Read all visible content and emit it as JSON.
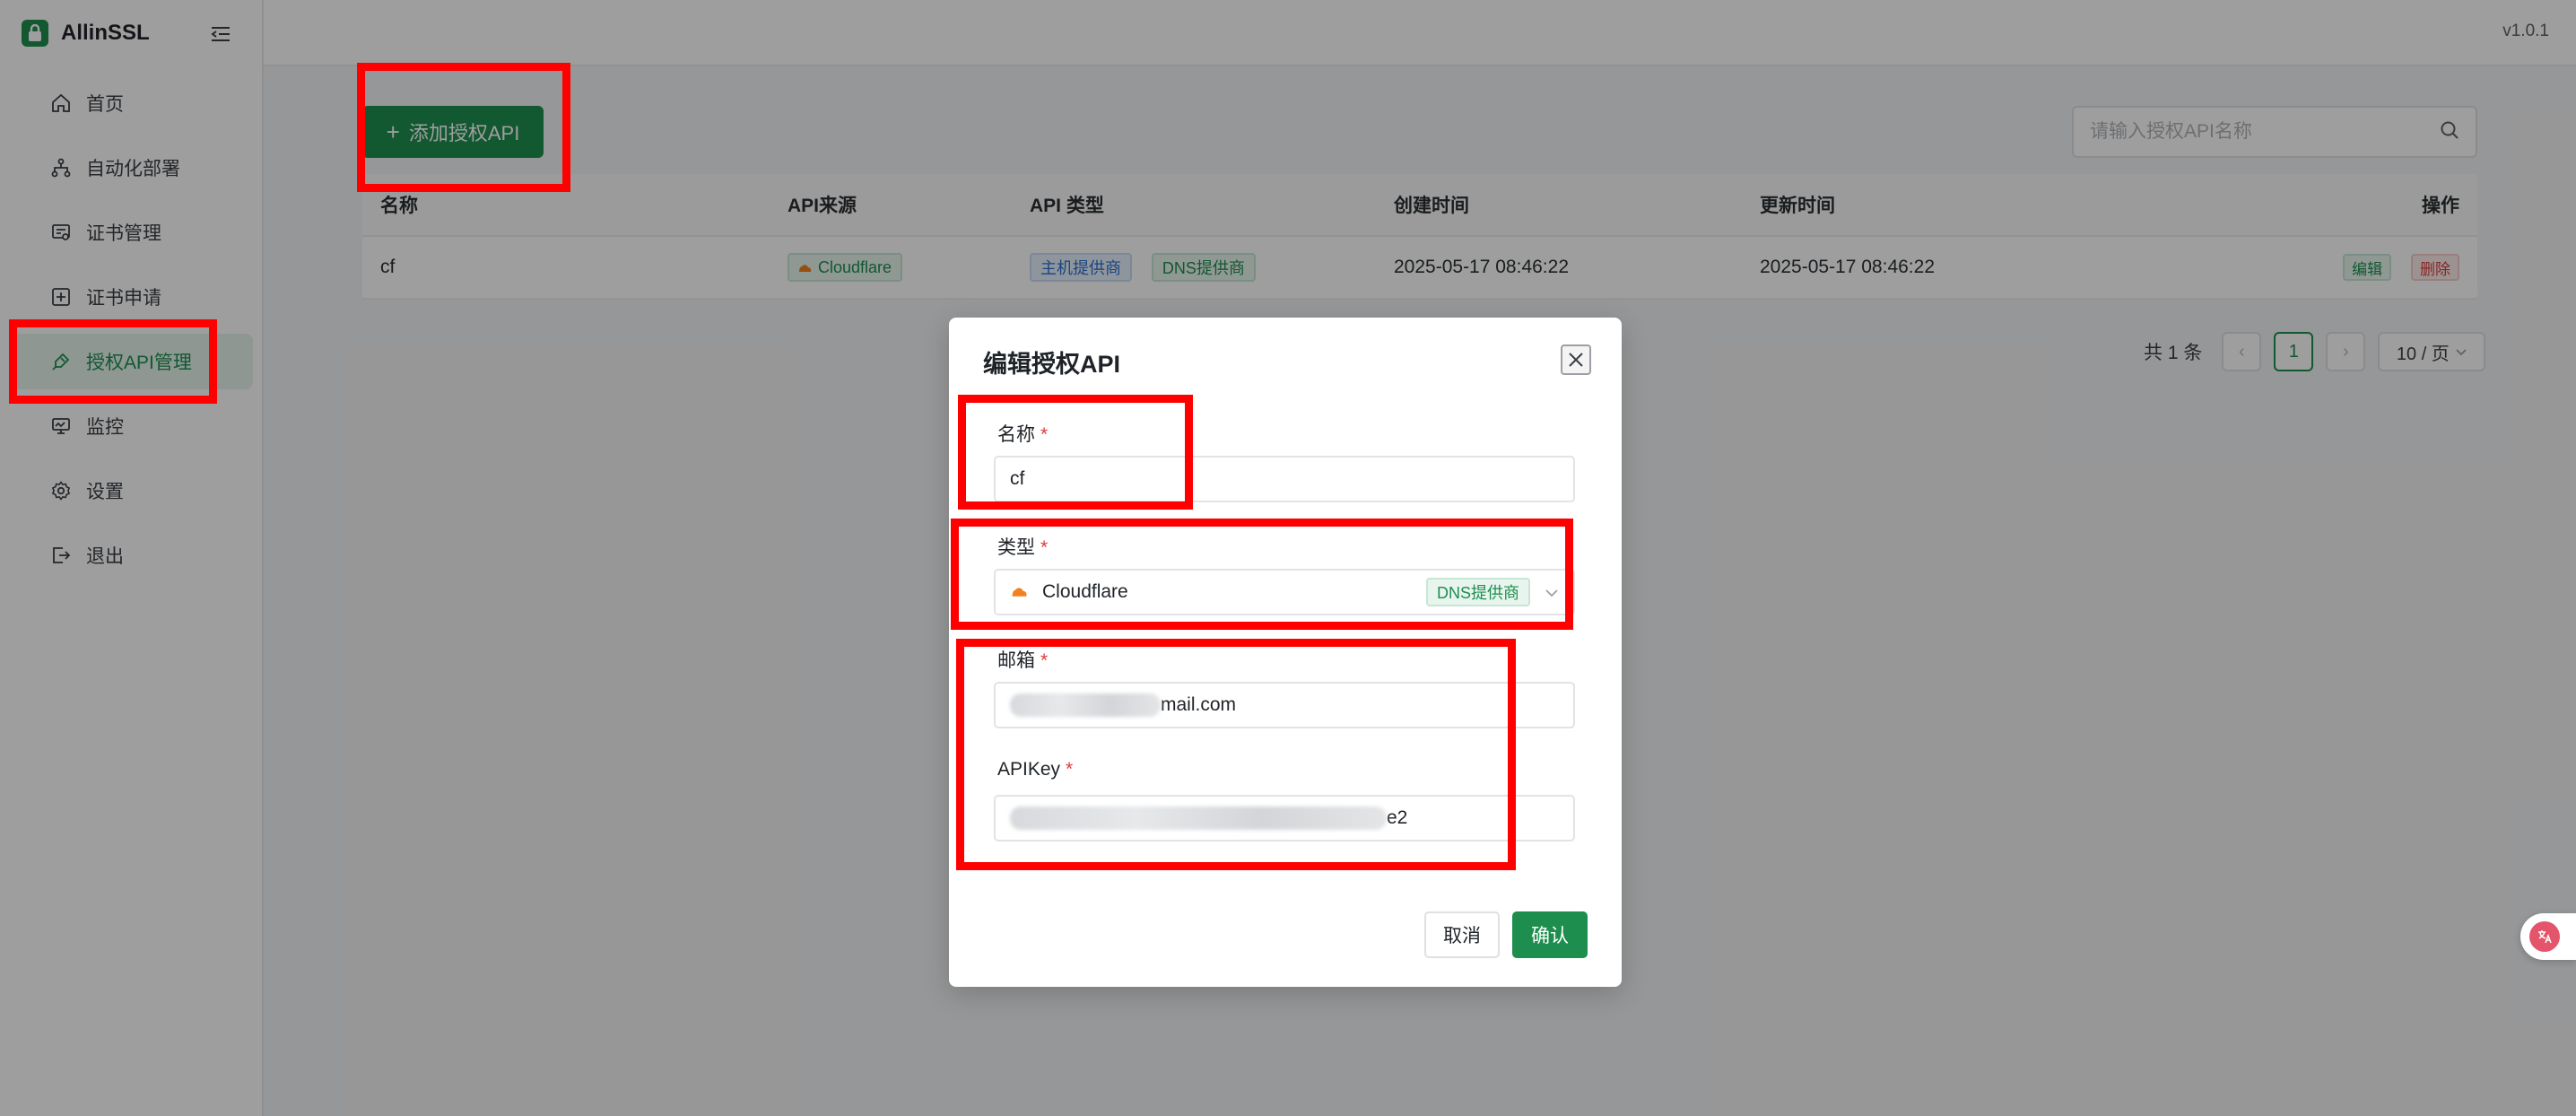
{
  "app": {
    "name": "AllinSSL",
    "version": "v1.0.1"
  },
  "sidebar": {
    "items": [
      {
        "label": "首页",
        "icon": "home-icon"
      },
      {
        "label": "自动化部署",
        "icon": "workflow-icon"
      },
      {
        "label": "证书管理",
        "icon": "certificate-icon"
      },
      {
        "label": "证书申请",
        "icon": "plus-square-icon"
      },
      {
        "label": "授权API管理",
        "icon": "api-icon",
        "active": true
      },
      {
        "label": "监控",
        "icon": "monitor-icon"
      },
      {
        "label": "设置",
        "icon": "gear-icon"
      },
      {
        "label": "退出",
        "icon": "logout-icon"
      }
    ]
  },
  "toolbar": {
    "add_label": "添加授权API",
    "search_placeholder": "请输入授权API名称"
  },
  "table": {
    "columns": [
      "名称",
      "API来源",
      "API 类型",
      "创建时间",
      "更新时间",
      "操作"
    ],
    "rows": [
      {
        "name": "cf",
        "source": "Cloudflare",
        "types": [
          "主机提供商",
          "DNS提供商"
        ],
        "created": "2025-05-17 08:46:22",
        "updated": "2025-05-17 08:46:22",
        "edit": "编辑",
        "delete": "删除"
      }
    ]
  },
  "pagination": {
    "total": "共 1 条",
    "current": "1",
    "page_size": "10 / 页"
  },
  "modal": {
    "title": "编辑授权API",
    "name_label": "名称",
    "name_value": "cf",
    "type_label": "类型",
    "type_value": "Cloudflare",
    "type_tag": "DNS提供商",
    "email_label": "邮箱",
    "email_visible_suffix": "mail.com",
    "apikey_label": "APIKey",
    "apikey_visible_suffix": "e2",
    "required_mark": "*",
    "cancel_label": "取消",
    "confirm_label": "确认"
  },
  "colors": {
    "brand": "#1e8e4f",
    "annotation": "#ff0000",
    "required": "#e03b3b"
  }
}
